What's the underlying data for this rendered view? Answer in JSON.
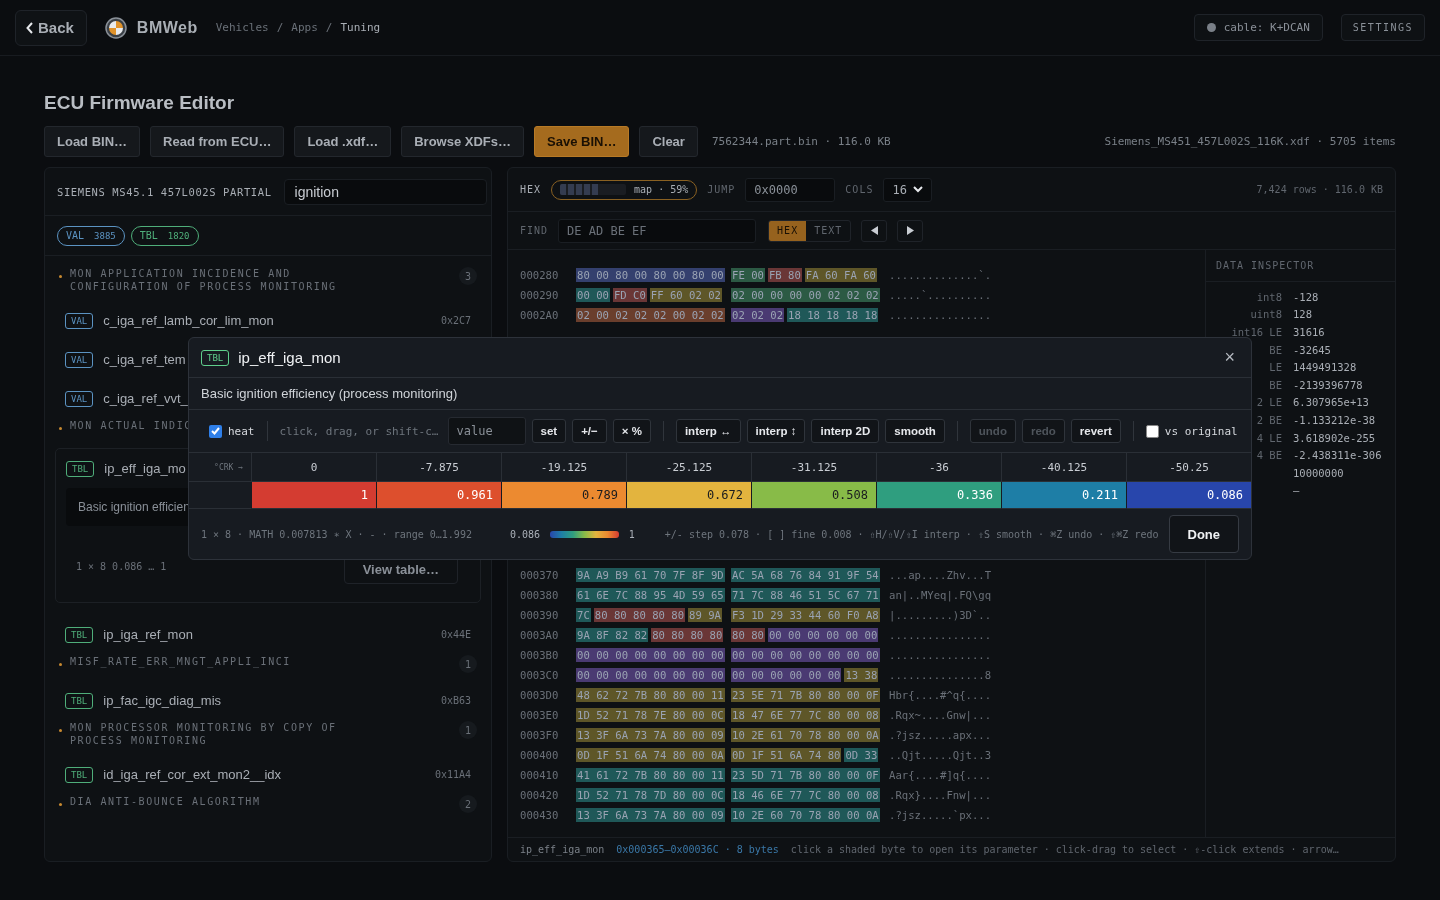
{
  "topbar": {
    "back": "Back",
    "brand": "BMWeb",
    "separator": "/",
    "breadcrumb": [
      {
        "label": "Vehicles",
        "selected": false
      },
      {
        "label": "Apps",
        "selected": false
      },
      {
        "label": "Tuning",
        "selected": true
      }
    ],
    "cable": "cable: K+DCAN",
    "settings": "SETTINGS"
  },
  "page": {
    "title": "ECU Firmware Editor",
    "actions": [
      {
        "label": "Load BIN…",
        "primary": false
      },
      {
        "label": "Read from ECU…",
        "primary": false
      },
      {
        "label": "Load .xdf…",
        "primary": false
      },
      {
        "label": "Browse XDFs…",
        "primary": false
      },
      {
        "label": "Save BIN…",
        "primary": true
      },
      {
        "label": "Clear",
        "primary": false
      }
    ],
    "file_info": "7562344.part.bin · 116.0 KB",
    "xdf_info": "Siemens_MS451_457L002S_116K.xdf · 5705 items"
  },
  "left_panel": {
    "title": "SIEMENS MS45.1 457L002S PARTIAL",
    "search": {
      "value": "ignition"
    },
    "filters": [
      {
        "color": "#5b93c2",
        "label": "VAL",
        "count": "3885",
        "selected": true
      },
      {
        "color": "#4fae7a",
        "label": "TBL",
        "count": "1820",
        "selected": true
      }
    ],
    "groups": [
      {
        "title": "MON APPLICATION INCIDENCE AND CONFIGURATION OF PROCESS MONITORING",
        "count": "3",
        "items": [
          {
            "color": "#5b93c2",
            "tag": "VAL",
            "name": "c_iga_ref_lamb_cor_lim_mon",
            "address": "0x2C7",
            "expanded": false
          },
          {
            "color": "#5b93c2",
            "tag": "VAL",
            "name": "c_iga_ref_tem",
            "expanded": false
          },
          {
            "color": "#5b93c2",
            "tag": "VAL",
            "name": "c_iga_ref_vvt_",
            "expanded": false
          }
        ]
      },
      {
        "title": "MON ACTUAL INDIC",
        "items": [
          {
            "color": "#4fae7a",
            "tag": "TBL",
            "name": "ip_eff_iga_mo",
            "expanded": true,
            "description": "Basic ignition efficien",
            "stats": "1 × 8  0.086 … 1",
            "button": "View table…"
          },
          {
            "color": "#4fae7a",
            "tag": "TBL",
            "name": "ip_iga_ref_mon",
            "address": "0x44E",
            "expanded": false
          }
        ]
      },
      {
        "title": "MISF_RATE_ERR_MNGT_APPLI_INCI",
        "count": "1",
        "items": [
          {
            "color": "#4fae7a",
            "tag": "TBL",
            "name": "ip_fac_igc_diag_mis",
            "address": "0xB63",
            "expanded": false
          }
        ]
      },
      {
        "title": "MON PROCESSOR MONITORING BY COPY OF PROCESS MONITORING",
        "count": "1",
        "items": [
          {
            "color": "#4fae7a",
            "tag": "TBL",
            "name": "id_iga_ref_cor_ext_mon2__idx",
            "address": "0x11A4",
            "expanded": false
          }
        ]
      },
      {
        "title": "DIA ANTI-BOUNCE ALGORITHM",
        "count": "2"
      }
    ]
  },
  "hex_panel": {
    "label": "HEX",
    "map": {
      "label": "map · 59%",
      "level": 0.59
    },
    "jump": {
      "label": "JUMP",
      "value": "0x0000"
    },
    "cols": {
      "label": "COLS",
      "value": "16"
    },
    "summary": "7,424 rows · 116.0 KB",
    "find": {
      "label": "FIND",
      "placeholder": "DE AD BE EF",
      "modes": [
        {
          "label": "HEX",
          "selected": true
        },
        {
          "label": "TEXT",
          "selected": false
        }
      ]
    },
    "rows_top": [
      {
        "address": "000280",
        "groups": [
          [
            {
              "bytes": "80 00 80 00 80 00 80 00",
              "color": "#34406e"
            }
          ],
          [
            {
              "bytes": "FE 00",
              "color": "#2c5a44"
            },
            {
              "bytes": "FB 80",
              "color": "#6a3636"
            },
            {
              "bytes": "FA 60 FA 60",
              "color": "#5e5628"
            }
          ]
        ],
        "ascii": "..............`."
      },
      {
        "address": "000290",
        "groups": [
          [
            {
              "bytes": "00 00",
              "color": "#1f5858"
            },
            {
              "bytes": "FD C0",
              "color": "#6a3636"
            },
            {
              "bytes": "FF 60 02 02",
              "color": "#5e5628"
            }
          ],
          [
            {
              "bytes": "02 00 00 00 00 02 02 02",
              "color": "#2c5a44"
            }
          ]
        ],
        "ascii": ".....`.........."
      },
      {
        "address": "0002A0",
        "groups": [
          [
            {
              "bytes": "02 00 02 02 02 00 02 02",
              "color": "#6a3e2c"
            }
          ],
          [
            {
              "bytes": "02 02 02",
              "color": "#4a3a72"
            },
            {
              "bytes": "18 18 18 18 18",
              "color": "#1f5858"
            }
          ]
        ],
        "ascii": "................"
      }
    ],
    "rows_bottom": [
      {
        "address": "000370",
        "groups": [
          [
            {
              "bytes": "9A A9 B9 61 70 7F 8F 9D",
              "color": "#1f5858"
            }
          ],
          [
            {
              "bytes": "AC 5A 68 76 84 91 9F 54",
              "color": "#1f5858"
            }
          ]
        ],
        "ascii": "...ap....Zhv...T"
      },
      {
        "address": "000380",
        "groups": [
          [
            {
              "bytes": "61 6E 7C 88 95 4D 59 65",
              "color": "#1f5858"
            }
          ],
          [
            {
              "bytes": "71 7C 88 46 51 5C 67 71",
              "color": "#1f5858"
            }
          ]
        ],
        "ascii": "an|..MYeq|.FQ\\gq"
      },
      {
        "address": "000390",
        "groups": [
          [
            {
              "bytes": "7C",
              "color": "#1f5858"
            },
            {
              "bytes": "80 80 80 80 80",
              "color": "#6a3636"
            },
            {
              "bytes": "89 9A",
              "color": "#5e5628"
            }
          ],
          [
            {
              "bytes": "F3 1D 29 33 44 60 F0 A8",
              "color": "#5e5628"
            }
          ]
        ],
        "ascii": "|.........)3D`.."
      },
      {
        "address": "0003A0",
        "groups": [
          [
            {
              "bytes": "9A 8F 82 82",
              "color": "#1f5858"
            },
            {
              "bytes": "80 80 80 80",
              "color": "#6a3636"
            }
          ],
          [
            {
              "bytes": "80 80",
              "color": "#6a3636"
            },
            {
              "bytes": "00 00 00 00 00 00",
              "color": "#4a3a72"
            }
          ]
        ],
        "ascii": "................"
      },
      {
        "address": "0003B0",
        "groups": [
          [
            {
              "bytes": "00 00 00 00 00 00 00 00",
              "color": "#4a3a72"
            }
          ],
          [
            {
              "bytes": "00 00 00 00 00 00 00 00",
              "color": "#4a3a72"
            }
          ]
        ],
        "ascii": "................"
      },
      {
        "address": "0003C0",
        "groups": [
          [
            {
              "bytes": "00 00 00 00 00 00 00 00",
              "color": "#4a3a72"
            }
          ],
          [
            {
              "bytes": "00 00 00 00 00 00",
              "color": "#4a3a72"
            },
            {
              "bytes": "13 38",
              "color": "#5e5628"
            }
          ]
        ],
        "ascii": "...............8"
      },
      {
        "address": "0003D0",
        "groups": [
          [
            {
              "bytes": "48 62 72 7B 80 80 00 11",
              "color": "#5e5628"
            }
          ],
          [
            {
              "bytes": "23 5E 71 7B 80 80 00 0F",
              "color": "#5e5628"
            }
          ]
        ],
        "ascii": "Hbr{....#^q{...."
      },
      {
        "address": "0003E0",
        "groups": [
          [
            {
              "bytes": "1D 52 71 78 7E 80 00 0C",
              "color": "#5e5628"
            }
          ],
          [
            {
              "bytes": "18 47 6E 77 7C 80 00 08",
              "color": "#5e5628"
            }
          ]
        ],
        "ascii": ".Rqx~....Gnw|..."
      },
      {
        "address": "0003F0",
        "groups": [
          [
            {
              "bytes": "13 3F 6A 73 7A 80 00 09",
              "color": "#5e5628"
            }
          ],
          [
            {
              "bytes": "10 2E 61 70 78 80 00 0A",
              "color": "#5e5628"
            }
          ]
        ],
        "ascii": ".?jsz.....apx..."
      },
      {
        "address": "000400",
        "groups": [
          [
            {
              "bytes": "0D 1F 51 6A 74 80 00 0A",
              "color": "#5e5628"
            }
          ],
          [
            {
              "bytes": "0D 1F 51 6A 74 80",
              "color": "#5e5628"
            },
            {
              "bytes": "0D 33",
              "color": "#1f5858"
            }
          ]
        ],
        "ascii": "..Qjt.....Qjt..3"
      },
      {
        "address": "000410",
        "groups": [
          [
            {
              "bytes": "41 61 72 7B 80 80 00 11",
              "color": "#1f5858"
            }
          ],
          [
            {
              "bytes": "23 5D 71 7B 80 80 00 0F",
              "color": "#1f5858"
            }
          ]
        ],
        "ascii": "Aar{....#]q{...."
      },
      {
        "address": "000420",
        "groups": [
          [
            {
              "bytes": "1D 52 71 78 7D 80 00 0C",
              "color": "#1f5858"
            }
          ],
          [
            {
              "bytes": "18 46 6E 77 7C 80 00 08",
              "color": "#1f5858"
            }
          ]
        ],
        "ascii": ".Rqx}....Fnw|..."
      },
      {
        "address": "000430",
        "groups": [
          [
            {
              "bytes": "13 3F 6A 73 7A 80 00 09",
              "color": "#1f5858"
            }
          ],
          [
            {
              "bytes": "10 2E 60 70 78 80 00 0A",
              "color": "#1f5858"
            }
          ]
        ],
        "ascii": ".?jsz.....`px..."
      }
    ],
    "inspector": {
      "title": "DATA INSPECTOR",
      "rows": [
        {
          "label": "int8",
          "value": "-128"
        },
        {
          "label": "uint8",
          "value": "128"
        },
        {
          "label": "int16 LE",
          "value": "31616"
        },
        {
          "label": "BE",
          "value": "-32645"
        },
        {
          "label": "LE",
          "value": "1449491328"
        },
        {
          "label": "BE",
          "value": "-2139396778"
        },
        {
          "label": "2 LE",
          "value": "6.307965e+13"
        },
        {
          "label": "2 BE",
          "value": "-1.133212e-38"
        },
        {
          "label": "4 LE",
          "value": "3.618902e-255"
        },
        {
          "label": "4 BE",
          "value": "-2.438311e-306"
        },
        {
          "value": "10000000"
        },
        {
          "value": "–"
        }
      ]
    },
    "status": {
      "name": "ip_eff_iga_mon",
      "range": "0x000365–0x00036C · 8 bytes",
      "hint": "click a shaded byte to open its parameter · click-drag to select · ⇧-click extends · arrow…"
    }
  },
  "modal": {
    "color": "#5fcf8c",
    "tag": "TBL",
    "title": "ip_eff_iga_mon",
    "close": "×",
    "description": "Basic ignition efficiency (process monitoring)",
    "heat": {
      "label": "heat",
      "checked": true
    },
    "hint": "click, drag, or shift-c…",
    "value_input": {
      "placeholder": "value"
    },
    "button_groups": [
      [
        {
          "label": "set",
          "disabled": false
        },
        {
          "label": "+/−",
          "disabled": false
        },
        {
          "label": "× %",
          "disabled": false
        }
      ],
      [
        {
          "label": "interp ↔",
          "disabled": false
        },
        {
          "label": "interp ↕",
          "disabled": false
        },
        {
          "label": "interp 2D",
          "disabled": false
        },
        {
          "label": "smooth",
          "disabled": false
        }
      ],
      [
        {
          "label": "undo",
          "disabled": true
        },
        {
          "label": "redo",
          "disabled": true
        },
        {
          "label": "revert",
          "disabled": false
        }
      ]
    ],
    "vs_original": {
      "label": "vs original",
      "checked": false
    },
    "table": {
      "axis": "°CRK →",
      "columns": [
        "0",
        "-7.875",
        "-19.125",
        "-25.125",
        "-31.125",
        "-36",
        "-40.125",
        "-50.25"
      ],
      "cells": [
        {
          "value": "1",
          "color": "#d43c31"
        },
        {
          "value": "0.961",
          "color": "#dd4f2d"
        },
        {
          "value": "0.789",
          "color": "#ec8a30"
        },
        {
          "value": "0.672",
          "color": "#e3b43e"
        },
        {
          "value": "0.508",
          "color": "#88bb48"
        },
        {
          "value": "0.336",
          "color": "#2f9e7f"
        },
        {
          "value": "0.211",
          "color": "#1e7ea6"
        },
        {
          "value": "0.086",
          "color": "#2846ac"
        }
      ]
    },
    "footer": {
      "info": "1 × 8 · MATH 0.007813 ∗ X · - · range 0…1.992",
      "legend_min": "0.086",
      "legend_max": "1",
      "shortcuts": "+/- step 0.078 · [ ] fine 0.008 · ⇧H/⇧V/⇧I interp · ⇧S smooth · ⌘Z undo · ⇧⌘Z redo"
    },
    "done": "Done"
  }
}
